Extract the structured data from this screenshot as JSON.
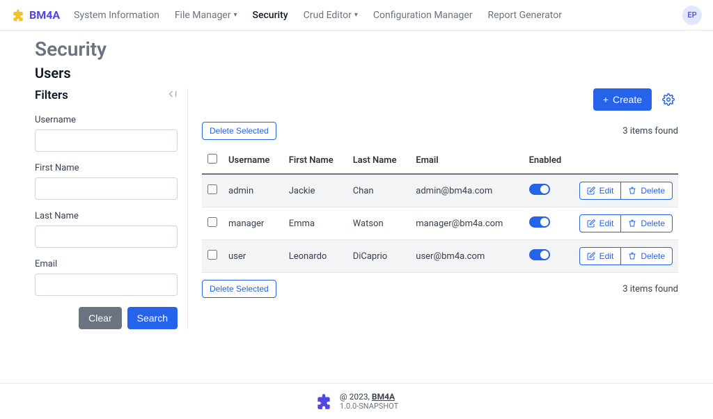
{
  "brand": "BM4A",
  "nav": {
    "items": [
      {
        "label": "System Information",
        "active": false,
        "hasDropdown": false
      },
      {
        "label": "File Manager",
        "active": false,
        "hasDropdown": true
      },
      {
        "label": "Security",
        "active": true,
        "hasDropdown": false
      },
      {
        "label": "Crud Editor",
        "active": false,
        "hasDropdown": true
      },
      {
        "label": "Configuration Manager",
        "active": false,
        "hasDropdown": false
      },
      {
        "label": "Report Generator",
        "active": false,
        "hasDropdown": false
      }
    ]
  },
  "avatar": "EP",
  "page": {
    "title": "Security",
    "subtitle": "Users"
  },
  "filters": {
    "title": "Filters",
    "fields": [
      {
        "label": "Username",
        "value": ""
      },
      {
        "label": "First Name",
        "value": ""
      },
      {
        "label": "Last Name",
        "value": ""
      },
      {
        "label": "Email",
        "value": ""
      }
    ],
    "clear": "Clear",
    "search": "Search"
  },
  "actions": {
    "create": "Create",
    "deleteSelected": "Delete Selected",
    "edit": "Edit",
    "delete": "Delete"
  },
  "itemsFound": "3 items found",
  "table": {
    "columns": [
      "Username",
      "First Name",
      "Last Name",
      "Email",
      "Enabled"
    ],
    "rows": [
      {
        "username": "admin",
        "firstName": "Jackie",
        "lastName": "Chan",
        "email": "admin@bm4a.com",
        "enabled": true
      },
      {
        "username": "manager",
        "firstName": "Emma",
        "lastName": "Watson",
        "email": "manager@bm4a.com",
        "enabled": true
      },
      {
        "username": "user",
        "firstName": "Leonardo",
        "lastName": "DiCaprio",
        "email": "user@bm4a.com",
        "enabled": true
      }
    ]
  },
  "footer": {
    "copyright": "@ 2023,",
    "brand": "BM4A",
    "version": "1.0.0-SNAPSHOT"
  }
}
